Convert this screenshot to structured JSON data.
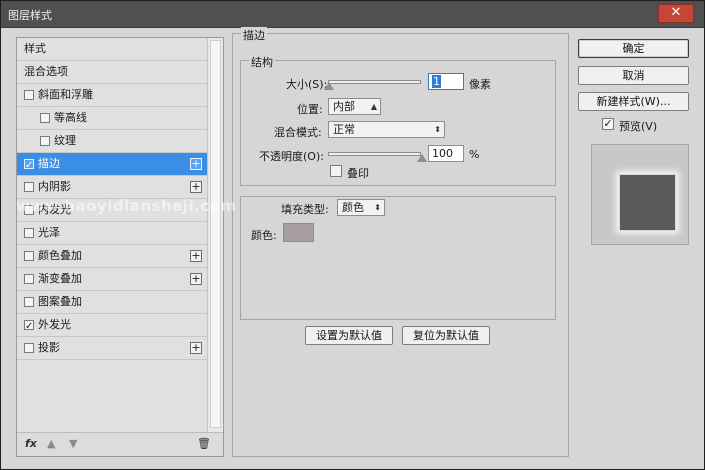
{
  "window": {
    "title": "图层样式",
    "close_icon": "close-icon"
  },
  "styles_list": {
    "header": "样式",
    "items": [
      {
        "label": "混合选项",
        "checkbox": false,
        "checked": false,
        "plus": false,
        "selected": false,
        "indent": false
      },
      {
        "label": "斜面和浮雕",
        "checkbox": true,
        "checked": false,
        "plus": false,
        "selected": false,
        "indent": false
      },
      {
        "label": "等高线",
        "checkbox": true,
        "checked": false,
        "plus": false,
        "selected": false,
        "indent": true
      },
      {
        "label": "纹理",
        "checkbox": true,
        "checked": false,
        "plus": false,
        "selected": false,
        "indent": true
      },
      {
        "label": "描边",
        "checkbox": true,
        "checked": true,
        "plus": true,
        "selected": true,
        "indent": false
      },
      {
        "label": "内阴影",
        "checkbox": true,
        "checked": false,
        "plus": true,
        "selected": false,
        "indent": false
      },
      {
        "label": "内发光",
        "checkbox": true,
        "checked": false,
        "plus": false,
        "selected": false,
        "indent": false
      },
      {
        "label": "光泽",
        "checkbox": true,
        "checked": false,
        "plus": false,
        "selected": false,
        "indent": false
      },
      {
        "label": "颜色叠加",
        "checkbox": true,
        "checked": false,
        "plus": true,
        "selected": false,
        "indent": false
      },
      {
        "label": "渐变叠加",
        "checkbox": true,
        "checked": false,
        "plus": true,
        "selected": false,
        "indent": false
      },
      {
        "label": "图案叠加",
        "checkbox": true,
        "checked": false,
        "plus": false,
        "selected": false,
        "indent": false
      },
      {
        "label": "外发光",
        "checkbox": true,
        "checked": true,
        "plus": false,
        "selected": false,
        "indent": false
      },
      {
        "label": "投影",
        "checkbox": true,
        "checked": false,
        "plus": true,
        "selected": false,
        "indent": false
      }
    ],
    "footer": {
      "fx": "fx",
      "up_icon": "arrow-up-icon",
      "down_icon": "arrow-down-icon",
      "trash_icon": "trash-icon"
    }
  },
  "stroke": {
    "title": "描边",
    "structure": {
      "title": "结构",
      "size_label": "大小(S):",
      "size_value": "1",
      "size_unit": "像素",
      "size_slider_fraction": 0.0,
      "position_label": "位置:",
      "position_value": "内部",
      "blend_label": "混合模式:",
      "blend_value": "正常",
      "opacity_label": "不透明度(O):",
      "opacity_value": "100",
      "opacity_unit": "%",
      "opacity_slider_fraction": 1.0,
      "overprint_label": "叠印",
      "overprint_checked": false
    },
    "fill": {
      "type_label": "填充类型:",
      "type_value": "颜色",
      "color_label": "颜色:",
      "color_value": "#a79ea2"
    },
    "make_default": "设置为默认值",
    "reset_default": "复位为默认值"
  },
  "buttons": {
    "ok": "确定",
    "cancel": "取消",
    "new_style": "新建样式(W)...",
    "preview_label": "预览(V)",
    "preview_checked": true
  },
  "watermark": "www.haoyidiansheji.com"
}
